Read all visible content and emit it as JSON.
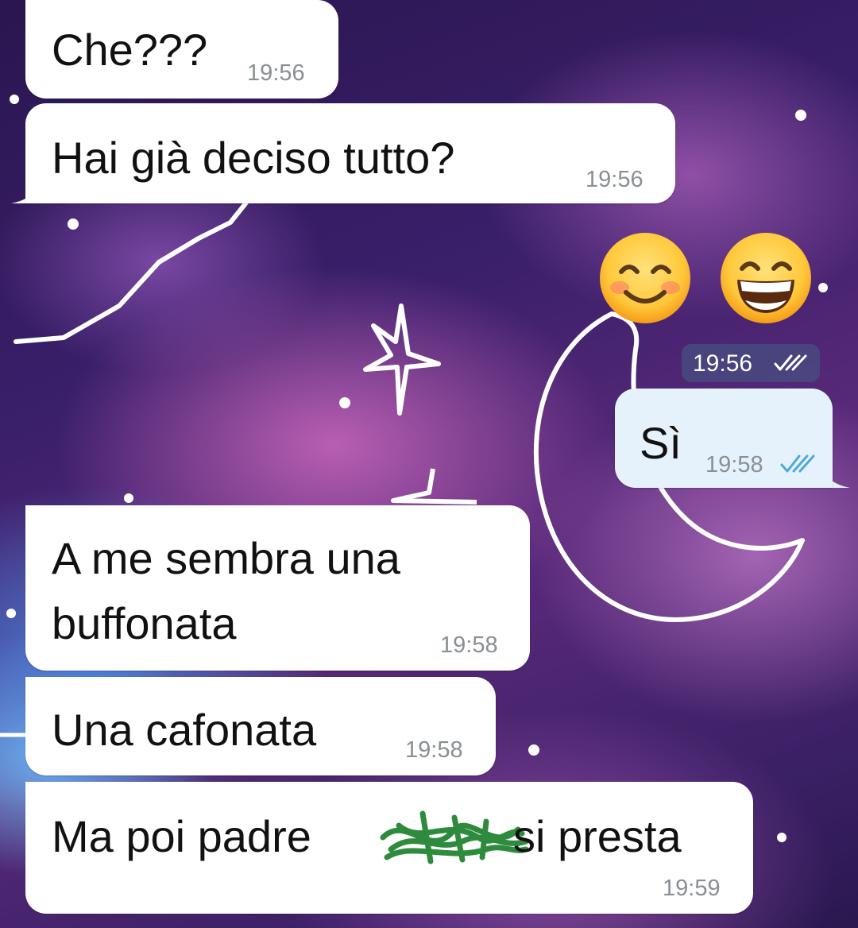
{
  "messages": [
    {
      "id": "m1",
      "direction": "in",
      "text": "Che???",
      "time": "19:56"
    },
    {
      "id": "m2",
      "direction": "in",
      "text": "Hai già deciso tutto?",
      "time": "19:56"
    },
    {
      "id": "m3",
      "direction": "out",
      "emojis": [
        "smiling-face-with-smiling-eyes",
        "grinning-face-with-smiling-eyes"
      ],
      "time": "19:56",
      "status": "read"
    },
    {
      "id": "m4",
      "direction": "out",
      "text": "Sì",
      "time": "19:58",
      "status": "read"
    },
    {
      "id": "m5",
      "direction": "in",
      "lines": [
        "A me sembra una",
        "buffonata"
      ],
      "time": "19:58"
    },
    {
      "id": "m6",
      "direction": "in",
      "text": "Una cafonata",
      "time": "19:58"
    },
    {
      "id": "m7",
      "direction": "in",
      "text_before": "Ma poi padre",
      "text_after": "si presta",
      "redacted": true,
      "time": "19:59"
    }
  ],
  "colors": {
    "incoming_bubble": "#ffffff",
    "outgoing_bubble": "#e6f2fb",
    "read_ticks_outgoing": "#4fa8d8",
    "redaction_scribble": "#2e8b3e"
  }
}
